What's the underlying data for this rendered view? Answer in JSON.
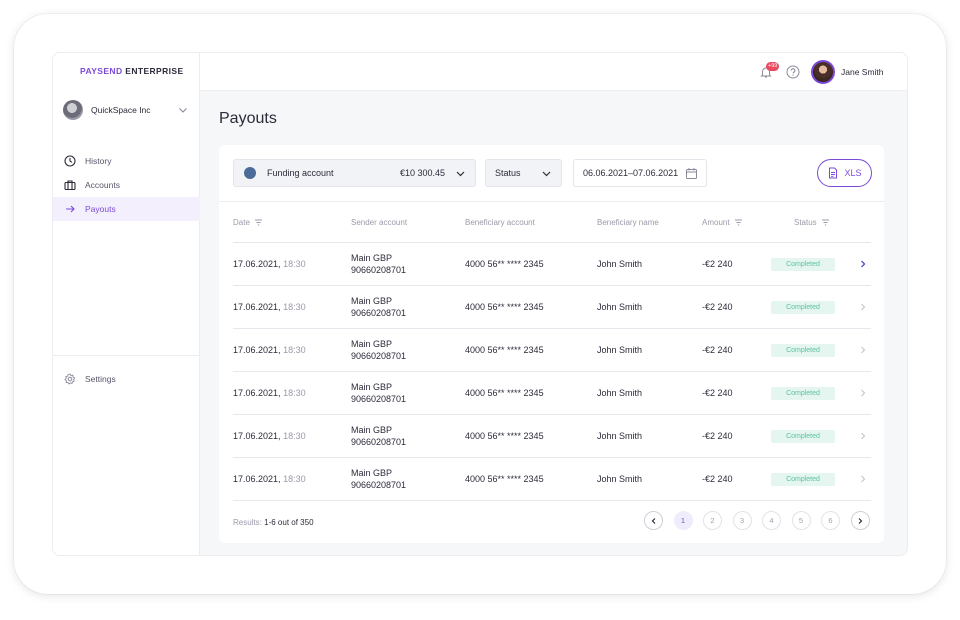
{
  "logo": {
    "brand": "PAYSEND",
    "suffix": "ENTERPRISE"
  },
  "company": {
    "name": "QuickSpace Inc"
  },
  "nav": {
    "items": [
      {
        "label": "History",
        "icon": "clock-icon"
      },
      {
        "label": "Accounts",
        "icon": "briefcase-icon"
      },
      {
        "label": "Payouts",
        "icon": "arrow-right-icon"
      }
    ],
    "settings": {
      "label": "Settings",
      "icon": "gear-icon"
    }
  },
  "topbar": {
    "notification_count": "+99",
    "user_name": "Jane Smith"
  },
  "page": {
    "title": "Payouts"
  },
  "filters": {
    "funding_label": "Funding account",
    "funding_amount": "€10 300.45",
    "status_label": "Status",
    "date_range": "06.06.2021–07.06.2021",
    "export_label": "XLS"
  },
  "table": {
    "headers": {
      "date": "Date",
      "sender": "Sender account",
      "beneficiary_account": "Beneficiary account",
      "beneficiary_name": "Beneficiary name",
      "amount": "Amount",
      "status": "Status"
    },
    "rows": [
      {
        "date": "17.06.2021,",
        "time": "18:30",
        "sender_name": "Main GBP",
        "sender_number": "90660208701",
        "beneficiary_account": "4000 56** **** 2345",
        "beneficiary_name": "John Smith",
        "amount": "-€2 240",
        "status": "Completed"
      },
      {
        "date": "17.06.2021,",
        "time": "18:30",
        "sender_name": "Main GBP",
        "sender_number": "90660208701",
        "beneficiary_account": "4000 56** **** 2345",
        "beneficiary_name": "John Smith",
        "amount": "-€2 240",
        "status": "Completed"
      },
      {
        "date": "17.06.2021,",
        "time": "18:30",
        "sender_name": "Main GBP",
        "sender_number": "90660208701",
        "beneficiary_account": "4000 56** **** 2345",
        "beneficiary_name": "John Smith",
        "amount": "-€2 240",
        "status": "Completed"
      },
      {
        "date": "17.06.2021,",
        "time": "18:30",
        "sender_name": "Main GBP",
        "sender_number": "90660208701",
        "beneficiary_account": "4000 56** **** 2345",
        "beneficiary_name": "John Smith",
        "amount": "-€2 240",
        "status": "Completed"
      },
      {
        "date": "17.06.2021,",
        "time": "18:30",
        "sender_name": "Main GBP",
        "sender_number": "90660208701",
        "beneficiary_account": "4000 56** **** 2345",
        "beneficiary_name": "John Smith",
        "amount": "-€2 240",
        "status": "Completed"
      },
      {
        "date": "17.06.2021,",
        "time": "18:30",
        "sender_name": "Main GBP",
        "sender_number": "90660208701",
        "beneficiary_account": "4000 56** **** 2345",
        "beneficiary_name": "John Smith",
        "amount": "-€2 240",
        "status": "Completed"
      }
    ]
  },
  "pagination": {
    "results_prefix": "Results:",
    "results_value": "1-6 out of 350",
    "pages": [
      "1",
      "2",
      "3",
      "4",
      "5",
      "6"
    ],
    "current_page": "1"
  },
  "colors": {
    "accent": "#7b4ad9",
    "success_bg": "#e4f6ef",
    "success_text": "#5ac49c",
    "badge": "#e84a5f"
  }
}
